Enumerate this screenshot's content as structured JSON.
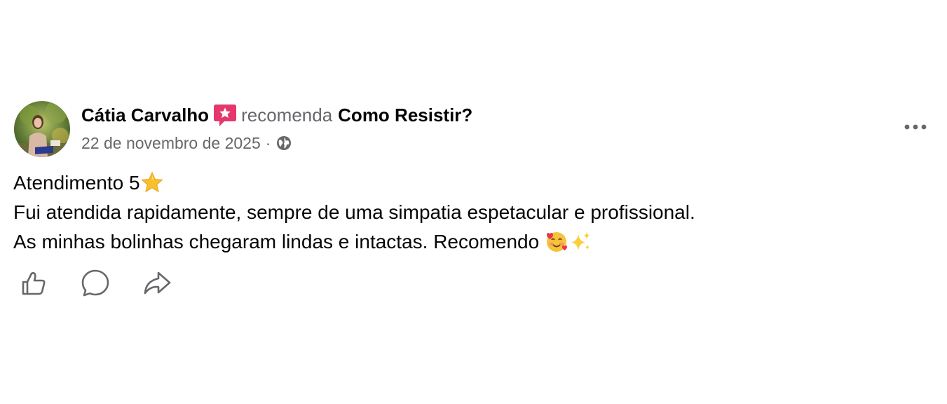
{
  "post": {
    "author_name": "Cátia Carvalho",
    "recommend_word": "recomenda",
    "page_name": "Como Resistir?",
    "date": "22 de novembro de 2025",
    "separator": "·",
    "audience_icon": "globe-icon",
    "more_icon": "more-options-icon",
    "body": {
      "line1": "Atendimento 5",
      "line1_emoji": "star-emoji",
      "line2": "Fui atendida rapidamente, sempre de uma simpatia espetacular e profissional.",
      "line3": "As minhas bolinhas chegaram lindas e intactas. Recomendo ",
      "line3_emojis": [
        "smiling-face-with-hearts-emoji",
        "sparkles-emoji"
      ]
    },
    "actions": [
      {
        "icon": "like-icon"
      },
      {
        "icon": "comment-icon"
      },
      {
        "icon": "share-icon"
      }
    ]
  },
  "colors": {
    "primary_text": "#050505",
    "secondary_text": "#65676b",
    "recommend_badge": "#e4386c",
    "icon_gray": "#65676b"
  }
}
